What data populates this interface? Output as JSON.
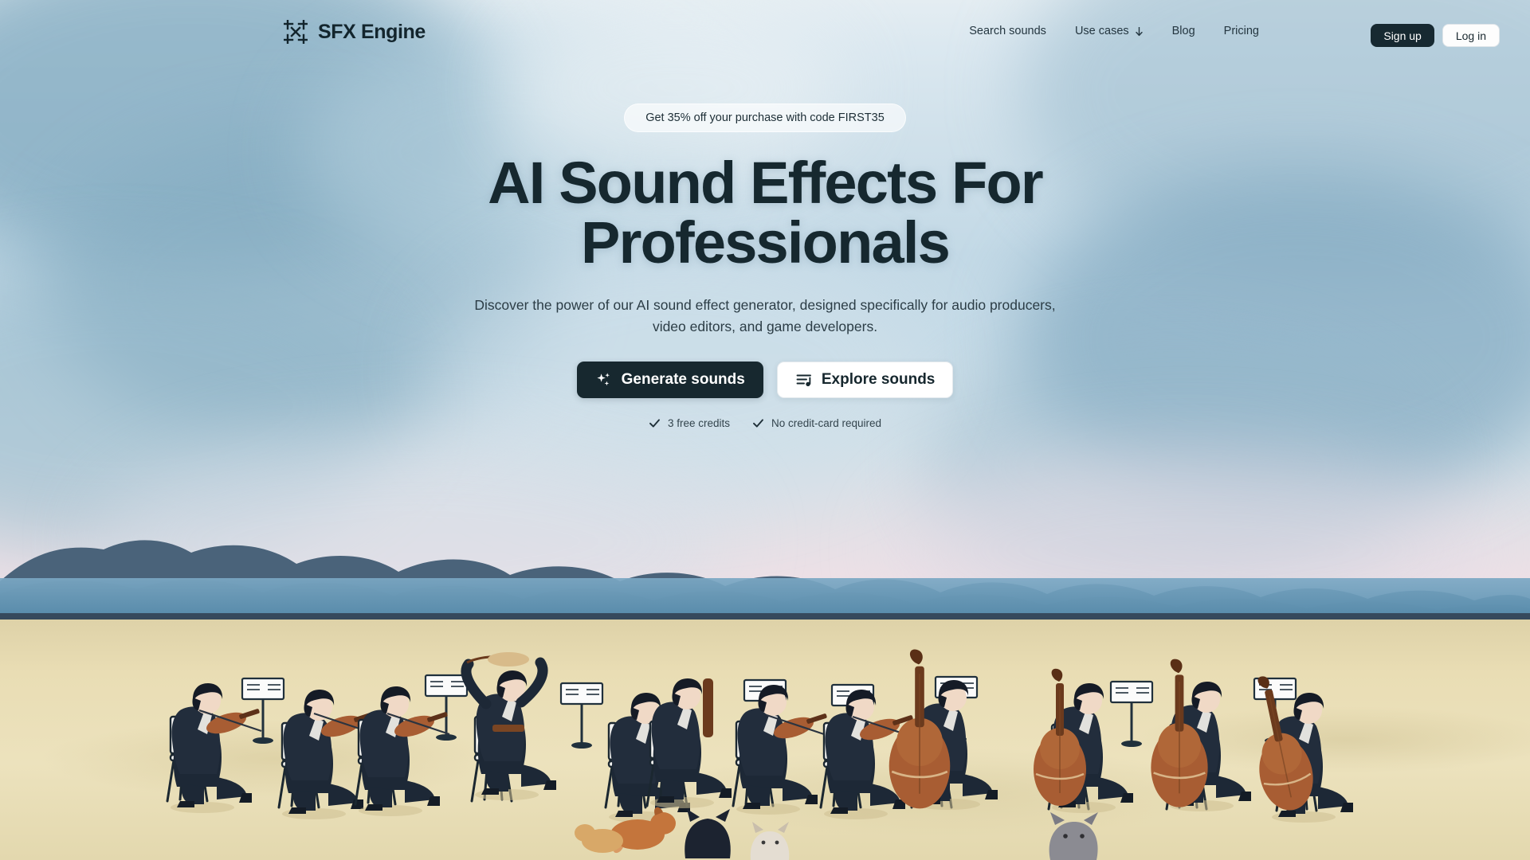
{
  "brand": {
    "name": "SFX Engine",
    "logo_icon": "converging-arrows-icon",
    "accent_dark": "#17282f",
    "text_dark": "#16282f"
  },
  "nav": {
    "items": [
      {
        "label": "Search sounds",
        "icon": null
      },
      {
        "label": "Use cases",
        "icon": "arrow-down-icon"
      },
      {
        "label": "Blog",
        "icon": null
      },
      {
        "label": "Pricing",
        "icon": null
      }
    ],
    "sign_up_label": "Sign up",
    "log_in_label": "Log in"
  },
  "hero": {
    "promo_text": "Get 35% off your purchase with code FIRST35",
    "headline": "AI Sound Effects For Professionals",
    "subtitle": "Discover the power of our AI sound effect generator, designed specifically for audio producers, video editors, and game developers.",
    "primary_cta": {
      "label": "Generate sounds",
      "icon": "sparkles-icon"
    },
    "secondary_cta": {
      "label": "Explore sounds",
      "icon": "playlist-music-icon"
    },
    "trust_items": [
      {
        "label": "3 free credits",
        "icon": "check-icon"
      },
      {
        "label": "No credit-card required",
        "icon": "check-icon"
      }
    ]
  },
  "illustration": {
    "description": "Illustrated outdoor orchestra of seated musicians in dark suits on a sandy field with a blue-grey treeline, water band, cats and dogs in the foreground",
    "colors": {
      "sky_top": "#dbe8f0",
      "sky_horizon": "#f4e3e9",
      "cloud": "#8fb3c6",
      "treeline": "#3d5468",
      "water": "#5d92b2",
      "sand": "#e8dcb0",
      "suit": "#1d2836",
      "instrument": "#a85d33"
    }
  }
}
